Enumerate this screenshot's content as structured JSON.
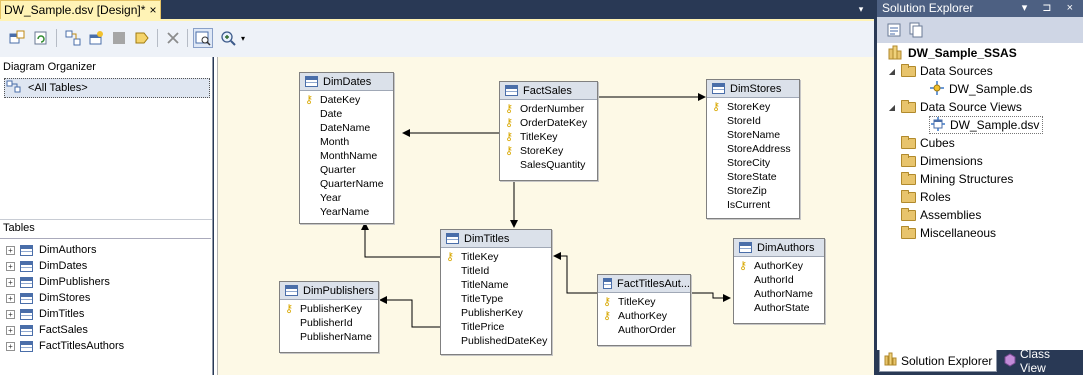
{
  "document": {
    "tab_title": "DW_Sample.dsv [Design]*",
    "close_glyph": "×",
    "dropdown_glyph": "▾"
  },
  "toolbar": {
    "buttons": [
      "add-remove-tables-icon",
      "refresh-icon",
      "new-relationship-icon",
      "new-named-query-icon",
      "replace-table-icon",
      "new-named-calculation-icon",
      "delete-icon",
      "find-table-icon",
      "zoom-icon"
    ],
    "zoom_dropdown_glyph": "▾"
  },
  "diagram_organizer": {
    "header": "Diagram Organizer",
    "items": [
      {
        "label": "<All Tables>"
      }
    ]
  },
  "tables_panel": {
    "header": "Tables",
    "items": [
      {
        "label": "DimAuthors",
        "expander": "+"
      },
      {
        "label": "DimDates",
        "expander": "+"
      },
      {
        "label": "DimPublishers",
        "expander": "+"
      },
      {
        "label": "DimStores",
        "expander": "+"
      },
      {
        "label": "DimTitles",
        "expander": "+"
      },
      {
        "label": "FactSales",
        "expander": "+"
      },
      {
        "label": "FactTitlesAuthors",
        "expander": "+"
      }
    ]
  },
  "diagram": {
    "key_glyph": "⚷",
    "tables": {
      "dimdates": {
        "name": "DimDates",
        "columns": [
          {
            "name": "DateKey",
            "key": true
          },
          {
            "name": "Date"
          },
          {
            "name": "DateName"
          },
          {
            "name": "Month"
          },
          {
            "name": "MonthName"
          },
          {
            "name": "Quarter"
          },
          {
            "name": "QuarterName"
          },
          {
            "name": "Year"
          },
          {
            "name": "YearName"
          }
        ]
      },
      "factsales": {
        "name": "FactSales",
        "columns": [
          {
            "name": "OrderNumber",
            "key": true
          },
          {
            "name": "OrderDateKey",
            "key": true
          },
          {
            "name": "TitleKey",
            "key": true
          },
          {
            "name": "StoreKey",
            "key": true
          },
          {
            "name": "SalesQuantity"
          }
        ]
      },
      "dimstores": {
        "name": "DimStores",
        "columns": [
          {
            "name": "StoreKey",
            "key": true
          },
          {
            "name": "StoreId"
          },
          {
            "name": "StoreName"
          },
          {
            "name": "StoreAddress"
          },
          {
            "name": "StoreCity"
          },
          {
            "name": "StoreState"
          },
          {
            "name": "StoreZip"
          },
          {
            "name": "IsCurrent"
          }
        ]
      },
      "dimtitles": {
        "name": "DimTitles",
        "columns": [
          {
            "name": "TitleKey",
            "key": true
          },
          {
            "name": "TitleId"
          },
          {
            "name": "TitleName"
          },
          {
            "name": "TitleType"
          },
          {
            "name": "PublisherKey"
          },
          {
            "name": "TitlePrice"
          },
          {
            "name": "PublishedDateKey"
          }
        ]
      },
      "dimpublishers": {
        "name": "DimPublishers",
        "columns": [
          {
            "name": "PublisherKey",
            "key": true
          },
          {
            "name": "PublisherId"
          },
          {
            "name": "PublisherName"
          }
        ]
      },
      "facttitlesauthors": {
        "name": "FactTitlesAut...",
        "columns": [
          {
            "name": "TitleKey",
            "key": true
          },
          {
            "name": "AuthorKey",
            "key": true
          },
          {
            "name": "AuthorOrder"
          }
        ]
      },
      "dimauthors": {
        "name": "DimAuthors",
        "columns": [
          {
            "name": "AuthorKey",
            "key": true
          },
          {
            "name": "AuthorId"
          },
          {
            "name": "AuthorName"
          },
          {
            "name": "AuthorState"
          }
        ]
      }
    }
  },
  "solution_explorer": {
    "title": "Solution Explorer",
    "title_buttons": "▾ ⊐ ×",
    "root": "DW_Sample_SSAS",
    "tree": [
      {
        "label": "Data Sources",
        "expander": "◢",
        "type": "folder"
      },
      {
        "label": "DW_Sample.ds",
        "type": "datasource"
      },
      {
        "label": "Data Source Views",
        "expander": "◢",
        "type": "folder"
      },
      {
        "label": "DW_Sample.dsv",
        "type": "dsv",
        "selected": true
      },
      {
        "label": "Cubes",
        "type": "folder"
      },
      {
        "label": "Dimensions",
        "type": "folder"
      },
      {
        "label": "Mining Structures",
        "type": "folder"
      },
      {
        "label": "Roles",
        "type": "folder"
      },
      {
        "label": "Assemblies",
        "type": "folder"
      },
      {
        "label": "Miscellaneous",
        "type": "folder"
      }
    ],
    "bottom_tabs": [
      "Solution Explorer",
      "Class View"
    ]
  },
  "colors": {
    "chrome_dark": "#293955",
    "diagram_bg": "#fdf9e6",
    "key_gold": "#d8a700",
    "tab_active": "#fff3b6"
  }
}
